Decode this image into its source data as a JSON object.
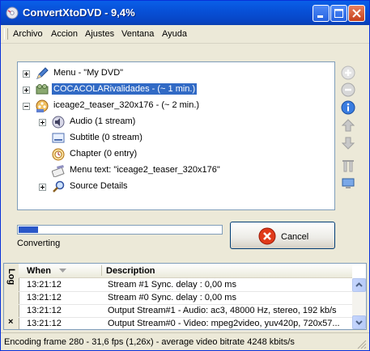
{
  "window": {
    "title": "ConvertXtoDVD - 9,4%",
    "colors": {
      "titlebar": "#0a5fe8",
      "selection": "#316ac5",
      "progress": "#2a58c8"
    }
  },
  "menubar": {
    "items": [
      "Archivo",
      "Accion",
      "Ajustes",
      "Ventana",
      "Ayuda"
    ]
  },
  "tree": {
    "menu": {
      "label": "Menu - \"My DVD\"",
      "icon": "pencil-icon"
    },
    "cocacola": {
      "label": "COCACOLARivalidades - (~ 1 min.)",
      "icon": "movie-icon",
      "selected": true
    },
    "iceage": {
      "label": "iceage2_teaser_320x176 - (~ 2 min.)",
      "icon": "film-reel-icon"
    },
    "audio": {
      "label": "Audio (1 stream)",
      "icon": "speaker-icon"
    },
    "subtitle": {
      "label": "Subtitle (0 stream)",
      "icon": "subtitle-icon"
    },
    "chapter": {
      "label": "Chapter (0 entry)",
      "icon": "chapter-icon"
    },
    "menu_text": {
      "label": "Menu text: \"iceage2_teaser_320x176\"",
      "icon": "text-icon"
    },
    "source": {
      "label": "Source Details",
      "icon": "magnifier-icon"
    }
  },
  "side_toolbar": [
    "add-icon",
    "remove-icon",
    "info-icon",
    "move-up-icon",
    "move-down-icon",
    "tools-icon",
    "monitor-icon"
  ],
  "progress": {
    "fraction": 0.094,
    "status": "Converting"
  },
  "cancel_button": {
    "label": "Cancel"
  },
  "log": {
    "tab_label": "Log",
    "close_glyph": "×",
    "columns": {
      "when": "When",
      "description": "Description"
    },
    "rows": [
      {
        "when": "13:21:12",
        "description": "Stream #1 Sync. delay : 0,00 ms"
      },
      {
        "when": "13:21:12",
        "description": "Stream #0 Sync. delay : 0,00 ms"
      },
      {
        "when": "13:21:12",
        "description": "Output Stream#1 - Audio: ac3, 48000 Hz, stereo, 192 kb/s"
      },
      {
        "when": "13:21:12",
        "description": "Output Stream#0 - Video: mpeg2video, yuv420p, 720x57..."
      }
    ]
  },
  "statusbar": {
    "text": "Encoding frame 280 - 31,6 fps (1,26x) - average video bitrate 4248 kbits/s"
  }
}
